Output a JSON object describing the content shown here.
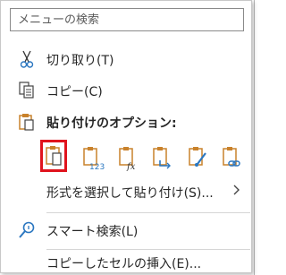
{
  "search": {
    "placeholder": "メニューの検索"
  },
  "menu": {
    "cut": "切り取り(T)",
    "copy": "コピー(C)",
    "paste_options_header": "貼り付けのオプション:",
    "paste_special": "形式を選択して貼り付け(S)...",
    "smart_lookup": "スマート検索(L)",
    "insert_copied_cells": "コピーしたセルの挿入(E)..."
  },
  "paste_options": [
    {
      "icon": "paste-icon",
      "selected": true
    },
    {
      "icon": "paste-values-icon",
      "label": "123"
    },
    {
      "icon": "paste-formulas-icon",
      "label": "fx"
    },
    {
      "icon": "paste-transpose-icon"
    },
    {
      "icon": "paste-formatting-icon"
    },
    {
      "icon": "paste-link-icon"
    }
  ],
  "colors": {
    "accent": "#e0131d",
    "icon_orange": "#c9822c",
    "icon_blue": "#2b77c0"
  }
}
